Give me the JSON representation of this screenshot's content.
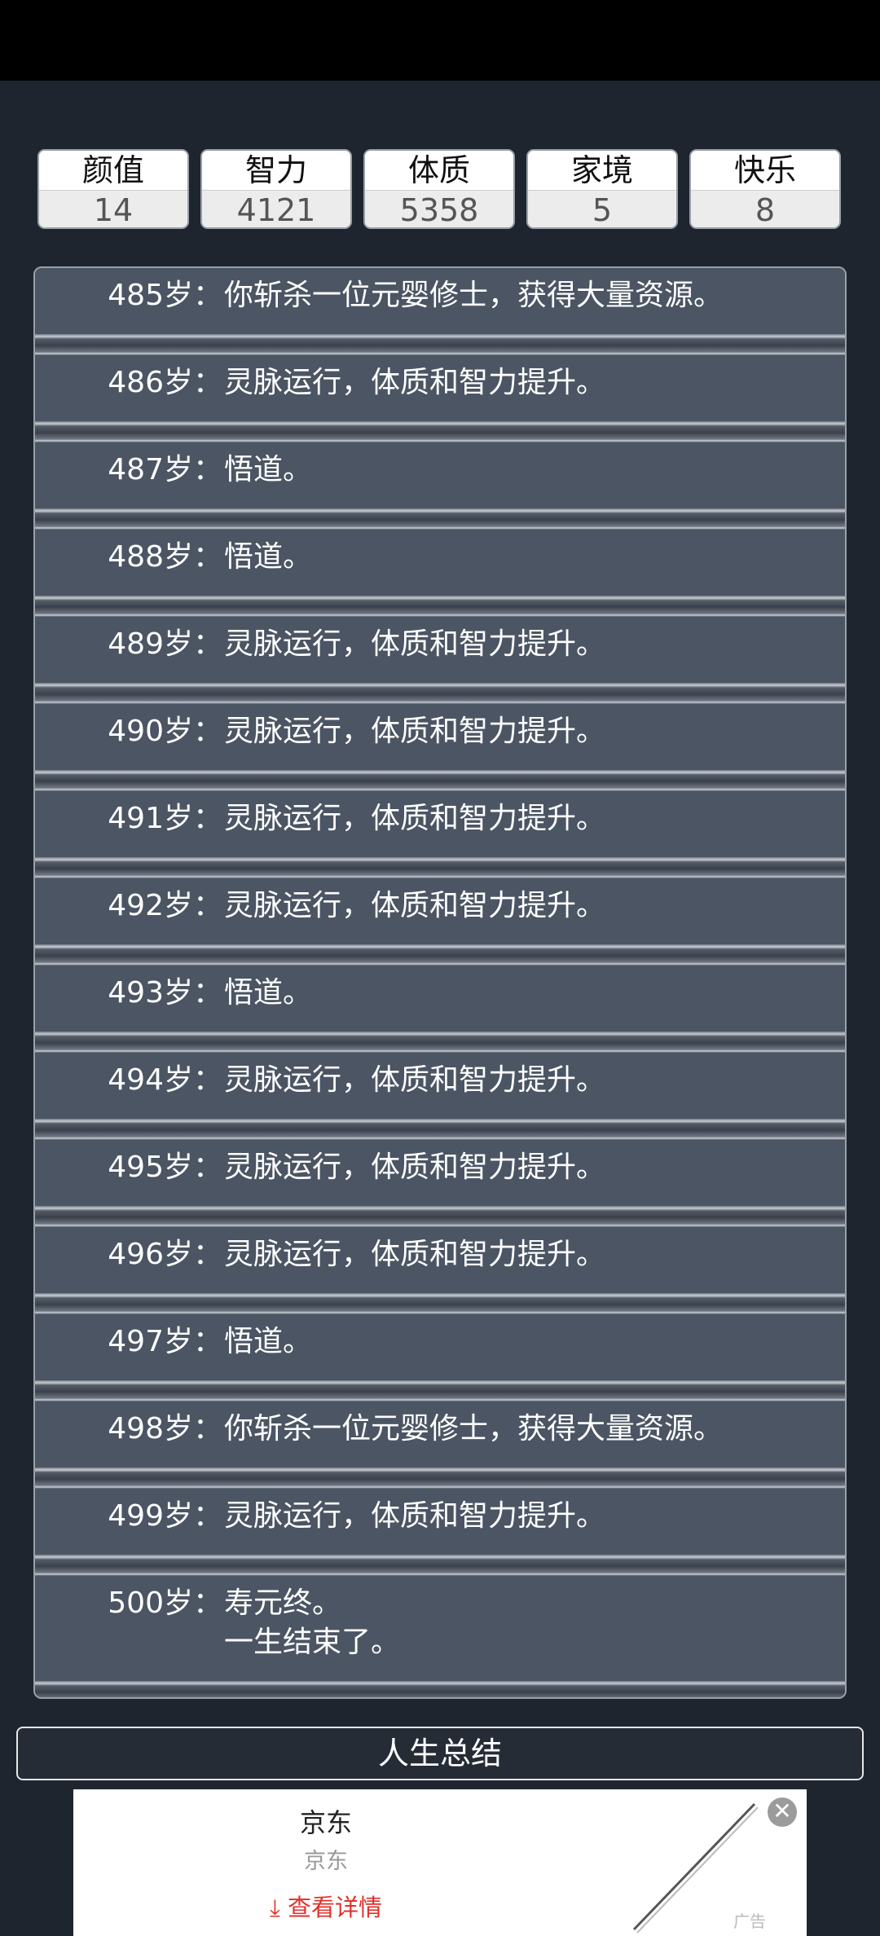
{
  "stats": [
    {
      "label": "颜值",
      "value": "14"
    },
    {
      "label": "智力",
      "value": "4121"
    },
    {
      "label": "体质",
      "value": "5358"
    },
    {
      "label": "家境",
      "value": "5"
    },
    {
      "label": "快乐",
      "value": "8"
    }
  ],
  "log": [
    {
      "age": "485岁：",
      "lines": [
        "你斩杀一位元婴修士，获得大量资源。"
      ]
    },
    {
      "age": "486岁：",
      "lines": [
        "灵脉运行，体质和智力提升。"
      ]
    },
    {
      "age": "487岁：",
      "lines": [
        "悟道。"
      ]
    },
    {
      "age": "488岁：",
      "lines": [
        "悟道。"
      ]
    },
    {
      "age": "489岁：",
      "lines": [
        "灵脉运行，体质和智力提升。"
      ]
    },
    {
      "age": "490岁：",
      "lines": [
        "灵脉运行，体质和智力提升。"
      ]
    },
    {
      "age": "491岁：",
      "lines": [
        "灵脉运行，体质和智力提升。"
      ]
    },
    {
      "age": "492岁：",
      "lines": [
        "灵脉运行，体质和智力提升。"
      ]
    },
    {
      "age": "493岁：",
      "lines": [
        "悟道。"
      ]
    },
    {
      "age": "494岁：",
      "lines": [
        "灵脉运行，体质和智力提升。"
      ]
    },
    {
      "age": "495岁：",
      "lines": [
        "灵脉运行，体质和智力提升。"
      ]
    },
    {
      "age": "496岁：",
      "lines": [
        "灵脉运行，体质和智力提升。"
      ]
    },
    {
      "age": "497岁：",
      "lines": [
        "悟道。"
      ]
    },
    {
      "age": "498岁：",
      "lines": [
        "你斩杀一位元婴修士，获得大量资源。"
      ]
    },
    {
      "age": "499岁：",
      "lines": [
        "灵脉运行，体质和智力提升。"
      ]
    },
    {
      "age": "500岁：",
      "lines": [
        "寿元终。",
        "一生结束了。"
      ]
    }
  ],
  "summary_button": "人生总结",
  "ad": {
    "title": "京东",
    "subtitle": "京东",
    "cta": "查看详情",
    "tag": "广告",
    "close_icon": "close-circle-icon",
    "cta_icon": "download-arrow-icon"
  }
}
